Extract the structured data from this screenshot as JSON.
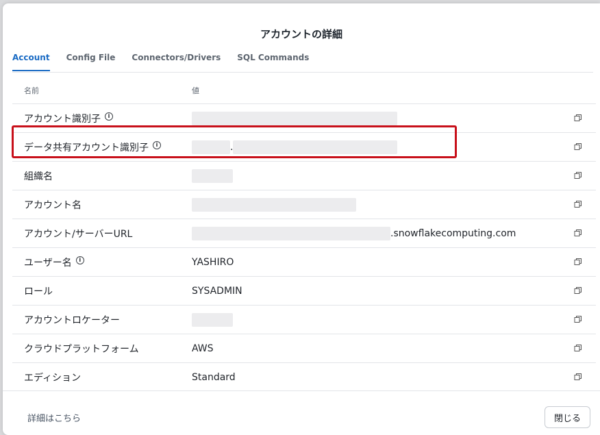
{
  "modal": {
    "title": "アカウントの詳細",
    "tabs": [
      {
        "label": "Account",
        "active": true
      },
      {
        "label": "Config File"
      },
      {
        "label": "Connectors/Drivers"
      },
      {
        "label": "SQL Commands"
      }
    ],
    "columns": {
      "name": "名前",
      "value": "値"
    },
    "rows": [
      {
        "label": "アカウント識別子",
        "info": true,
        "value": ""
      },
      {
        "label": "データ共有アカウント識別子",
        "info": true,
        "value": "."
      },
      {
        "label": "組織名",
        "info": false,
        "value": ""
      },
      {
        "label": "アカウント名",
        "info": false,
        "value": ""
      },
      {
        "label": "アカウント/サーバーURL",
        "info": false,
        "value": ".snowflakecomputing.com"
      },
      {
        "label": "ユーザー名",
        "info": true,
        "value": "YASHIRO"
      },
      {
        "label": "ロール",
        "info": false,
        "value": "SYSADMIN"
      },
      {
        "label": "アカウントロケーター",
        "info": false,
        "value": ""
      },
      {
        "label": "クラウドプラットフォーム",
        "info": false,
        "value": "AWS"
      },
      {
        "label": "エディション",
        "info": false,
        "value": "Standard"
      }
    ],
    "footer": {
      "more_link": "詳細はこちら",
      "close_label": "閉じる"
    },
    "colors": {
      "accent": "#1a6bc4",
      "highlight": "#c8101a"
    }
  }
}
